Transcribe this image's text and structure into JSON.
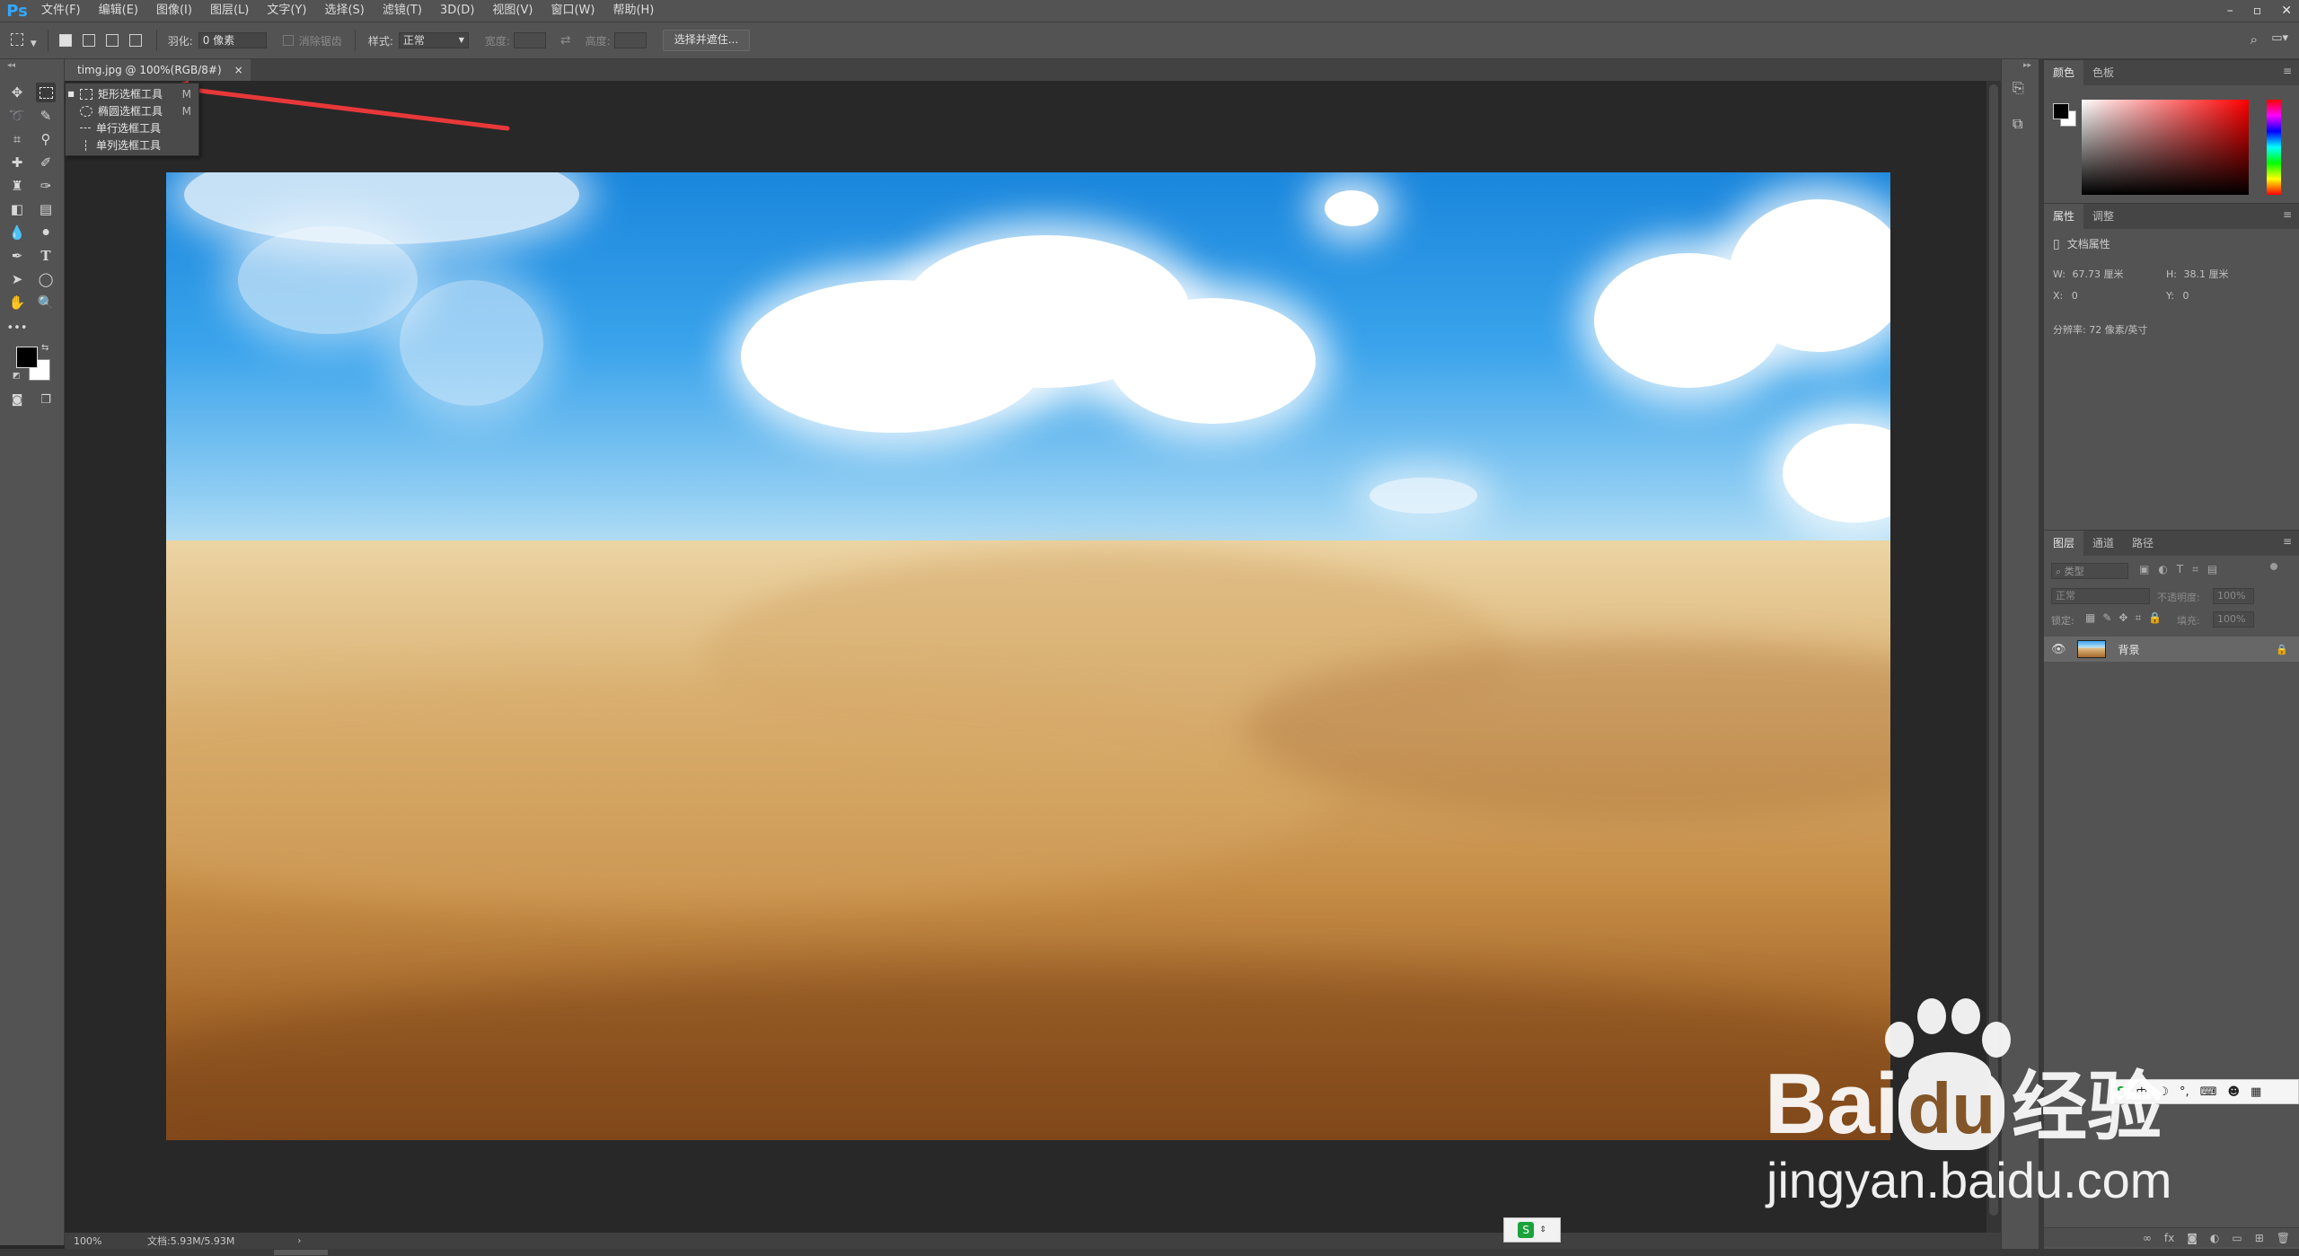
{
  "app": {
    "logo": "Ps"
  },
  "menu": [
    "文件(F)",
    "编辑(E)",
    "图像(I)",
    "图层(L)",
    "文字(Y)",
    "选择(S)",
    "滤镜(T)",
    "3D(D)",
    "视图(V)",
    "窗口(W)",
    "帮助(H)"
  ],
  "window_controls": [
    "–",
    "▫",
    "✕"
  ],
  "options": {
    "feather_label": "羽化:",
    "feather_value": "0 像素",
    "antialias_label": "消除锯齿",
    "style_label": "样式:",
    "style_value": "正常",
    "width_label": "宽度:",
    "height_label": "高度:",
    "select_mask_button": "选择并遮住..."
  },
  "document": {
    "tab_label": "timg.jpg @ 100%(RGB/8#)",
    "close_glyph": "×"
  },
  "flyout": {
    "items": [
      {
        "label": "矩形选框工具",
        "shortcut": "M",
        "icon": "rect-marquee-icon"
      },
      {
        "label": "椭圆选框工具",
        "shortcut": "M",
        "icon": "ellipse-marquee-icon"
      },
      {
        "label": "单行选框工具",
        "shortcut": "",
        "icon": "single-row-marquee-icon"
      },
      {
        "label": "单列选框工具",
        "shortcut": "",
        "icon": "single-column-marquee-icon"
      }
    ]
  },
  "color_panel": {
    "tabs": [
      "颜色",
      "色板"
    ]
  },
  "properties_panel": {
    "tabs": [
      "属性",
      "调整"
    ],
    "section_title": "文档属性",
    "w_label": "W:",
    "w_value": "67.73 厘米",
    "h_label": "H:",
    "h_value": "38.1 厘米",
    "x_label": "X:",
    "x_value": "0",
    "y_label": "Y:",
    "y_value": "0",
    "resolution": "分辨率: 72 像素/英寸"
  },
  "layers_panel": {
    "tabs": [
      "图层",
      "通道",
      "路径"
    ],
    "search_placeholder": "类型",
    "blend_mode": "正常",
    "opacity_label": "不透明度:",
    "opacity_value": "100%",
    "lock_label": "锁定:",
    "fill_label": "填充:",
    "fill_value": "100%",
    "layer_name": "背景"
  },
  "status": {
    "zoom": "100%",
    "doc_size": "文档:5.93M/5.93M"
  },
  "watermark": {
    "brand": "Bai",
    "brand2": "du",
    "cn": "经验",
    "url": "jingyan.baidu.com"
  },
  "colors": {
    "accent": "#31a8ff",
    "arrow": "#e8383a",
    "panel": "#535353",
    "canvas": "#282828"
  }
}
